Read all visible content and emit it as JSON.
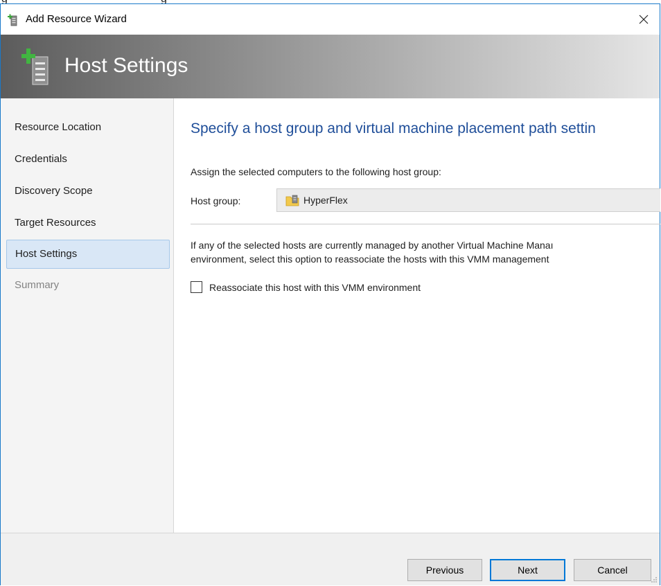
{
  "window": {
    "title": "Add Resource Wizard",
    "close_glyph": "✕"
  },
  "banner": {
    "title": "Host Settings",
    "icon": "server-add-icon"
  },
  "nav": {
    "items": [
      {
        "label": "Resource Location",
        "state": "normal"
      },
      {
        "label": "Credentials",
        "state": "normal"
      },
      {
        "label": "Discovery Scope",
        "state": "normal"
      },
      {
        "label": "Target Resources",
        "state": "normal"
      },
      {
        "label": "Host Settings",
        "state": "active"
      },
      {
        "label": "Summary",
        "state": "disabled"
      }
    ]
  },
  "main": {
    "heading": "Specify a host group and virtual machine placement path settin",
    "assign_text": "Assign the selected computers to the following host group:",
    "host_group_label": "Host group:",
    "host_group_value": "HyperFlex",
    "info_line1": "If any of the selected hosts are currently managed by another Virtual Machine Manaı",
    "info_line2": "environment, select this option to reassociate the hosts with this VMM management",
    "reassociate_label": "Reassociate this host with this VMM environment",
    "reassociate_checked": false
  },
  "footer": {
    "previous_label": "Previous",
    "next_label": "Next",
    "cancel_label": "Cancel"
  },
  "colors": {
    "heading": "#1f4e99",
    "active_nav": "#d9e7f6",
    "window_border": "#1979ca"
  }
}
